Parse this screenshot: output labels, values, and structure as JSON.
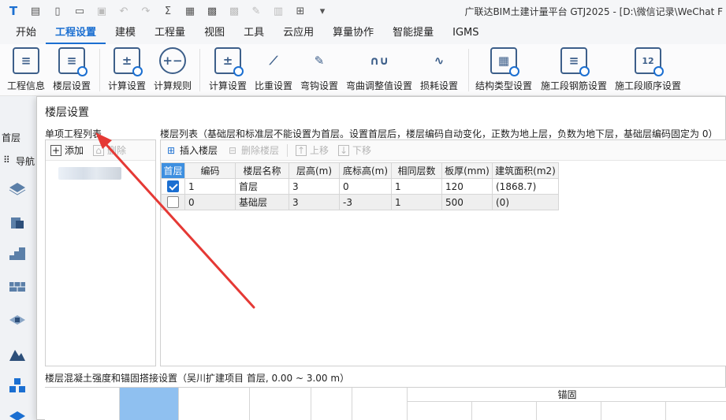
{
  "quick_access": {
    "icons": [
      "app-logo-icon",
      "new-file-icon",
      "new-doc-icon",
      "open-folder-icon",
      "save-icon",
      "undo-icon",
      "redo-icon",
      "sum-icon",
      "report-icon",
      "grid-icon",
      "dimmed-grid-icon",
      "draw-icon",
      "column-icon",
      "dimmed-plus-icon",
      "dropdown-icon"
    ]
  },
  "app": {
    "title": "广联达BIM土建计量平台 GTJ2025 - [D:\\微信记录\\WeChat F"
  },
  "menu": {
    "items": [
      "开始",
      "工程设置",
      "建模",
      "工程量",
      "视图",
      "工具",
      "云应用",
      "算量协作",
      "智能提量",
      "IGMS"
    ],
    "active": "工程设置"
  },
  "ribbon": {
    "buttons": [
      {
        "label": "工程信息",
        "icon": "project-info-icon"
      },
      {
        "label": "楼层设置",
        "icon": "floor-settings-icon"
      },
      {
        "label": "计算设置",
        "icon": "calc-settings-icon"
      },
      {
        "label": "计算规则",
        "icon": "calc-rules-icon"
      },
      {
        "label": "计算设置",
        "icon": "rebar-calc-settings-icon"
      },
      {
        "label": "比重设置",
        "icon": "density-settings-icon"
      },
      {
        "label": "弯钩设置",
        "icon": "hook-settings-icon"
      },
      {
        "label": "弯曲调整值设置",
        "icon": "bend-adjust-icon"
      },
      {
        "label": "损耗设置",
        "icon": "loss-settings-icon"
      },
      {
        "label": "结构类型设置",
        "icon": "structure-type-icon"
      },
      {
        "label": "施工段钢筋设置",
        "icon": "segment-rebar-icon"
      },
      {
        "label": "施工段顺序设置",
        "icon": "segment-order-icon"
      }
    ]
  },
  "left_panel": {
    "floor_label": "首层",
    "nav_label": "导航"
  },
  "dialog": {
    "title": "楼层设置",
    "project_list": {
      "title": "单项工程列表",
      "add_label": "添加",
      "delete_label": "删除"
    },
    "floor_list": {
      "title": "楼层列表（基础层和标准层不能设置为首层。设置首层后，楼层编码自动变化，正数为地上层，负数为地下层，基础层编码固定为 0）",
      "toolbar": {
        "insert_label": "插入楼层",
        "delete_label": "删除楼层",
        "up_label": "上移",
        "down_label": "下移"
      },
      "columns": [
        "首层",
        "编码",
        "楼层名称",
        "层高(m)",
        "底标高(m)",
        "相同层数",
        "板厚(mm)",
        "建筑面积(m2)"
      ],
      "rows": [
        {
          "first": true,
          "code": "1",
          "name": "首层",
          "height": "3",
          "bottom": "0",
          "same": "1",
          "thick": "120",
          "area": "(1868.7)"
        },
        {
          "first": false,
          "code": "0",
          "name": "基础层",
          "height": "3",
          "bottom": "-3",
          "same": "1",
          "thick": "500",
          "area": "(0)"
        }
      ]
    },
    "bottom": {
      "title": "楼层混凝土强度和锚固搭接设置（吴川扩建项目 首层, 0.00 ~ 3.00 m）",
      "anchor_label": "锚固"
    }
  },
  "colors": {
    "accent": "#1b6fd1",
    "header_blue": "#3d8fe0",
    "arrow_red": "#e53935"
  }
}
